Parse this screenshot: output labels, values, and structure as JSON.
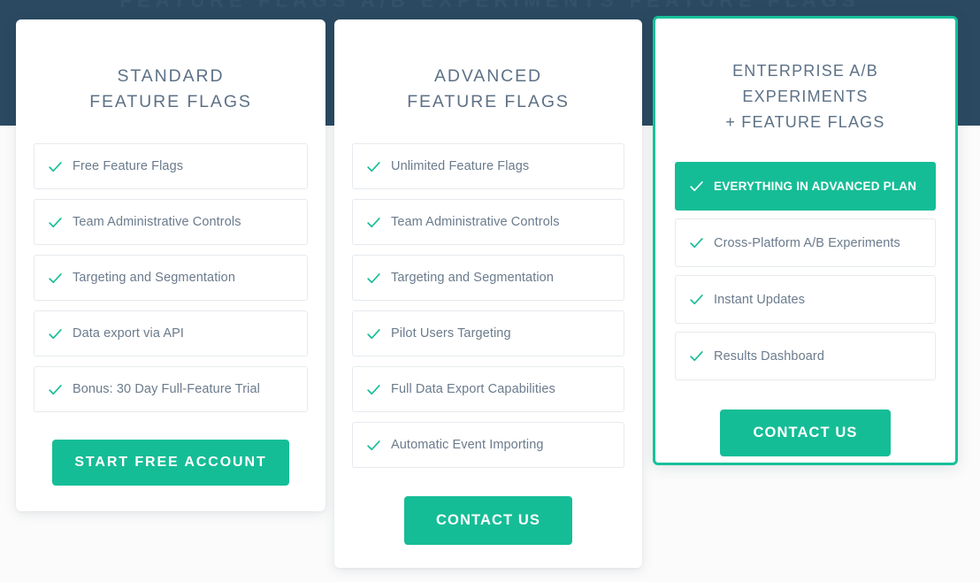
{
  "theme": {
    "band_color": "#2b4a61",
    "page_background": "#fbfbfb",
    "accent_green": "#15bd96",
    "highlight_border_green": "#17c09a",
    "title_color": "#5d7186",
    "feature_text_color": "#6b7b8c",
    "feature_border_color": "#e6eaee"
  },
  "band": {
    "ghost_text": "FEATURE FLAGS A/B EXPERIMENTS FEATURE FLAGS"
  },
  "plans": [
    {
      "id": "standard",
      "title_line1": "STANDARD",
      "title_line2": "FEATURE FLAGS",
      "featured": false,
      "features": [
        {
          "label": "Free Feature Flags",
          "highlight": false,
          "icon": "check-icon"
        },
        {
          "label": "Team Administrative Controls",
          "highlight": false,
          "icon": "check-icon"
        },
        {
          "label": "Targeting and Segmentation",
          "highlight": false,
          "icon": "check-icon"
        },
        {
          "label": "Data export via API",
          "highlight": false,
          "icon": "check-icon"
        },
        {
          "label": "Bonus: 30 Day Full-Feature Trial",
          "highlight": false,
          "icon": "check-icon"
        }
      ],
      "cta_label": "START FREE ACCOUNT"
    },
    {
      "id": "advanced",
      "title_line1": "ADVANCED",
      "title_line2": "FEATURE FLAGS",
      "featured": false,
      "features": [
        {
          "label": "Unlimited Feature Flags",
          "highlight": false,
          "icon": "check-icon"
        },
        {
          "label": "Team Administrative Controls",
          "highlight": false,
          "icon": "check-icon"
        },
        {
          "label": "Targeting and Segmentation",
          "highlight": false,
          "icon": "check-icon"
        },
        {
          "label": "Pilot Users Targeting",
          "highlight": false,
          "icon": "check-icon"
        },
        {
          "label": "Full Data Export Capabilities",
          "highlight": false,
          "icon": "check-icon"
        },
        {
          "label": "Automatic Event Importing",
          "highlight": false,
          "icon": "check-icon"
        }
      ],
      "cta_label": "CONTACT US"
    },
    {
      "id": "enterprise",
      "title_line1": "ENTERPRISE A/B EXPERIMENTS",
      "title_line2": "+ FEATURE FLAGS",
      "featured": true,
      "features": [
        {
          "label": "EVERYTHING IN ADVANCED PLAN",
          "highlight": true,
          "icon": "check-icon"
        },
        {
          "label": "Cross-Platform A/B Experiments",
          "highlight": false,
          "icon": "check-icon"
        },
        {
          "label": "Instant Updates",
          "highlight": false,
          "icon": "check-icon"
        },
        {
          "label": "Results Dashboard",
          "highlight": false,
          "icon": "check-icon"
        }
      ],
      "cta_label": "CONTACT US"
    }
  ]
}
